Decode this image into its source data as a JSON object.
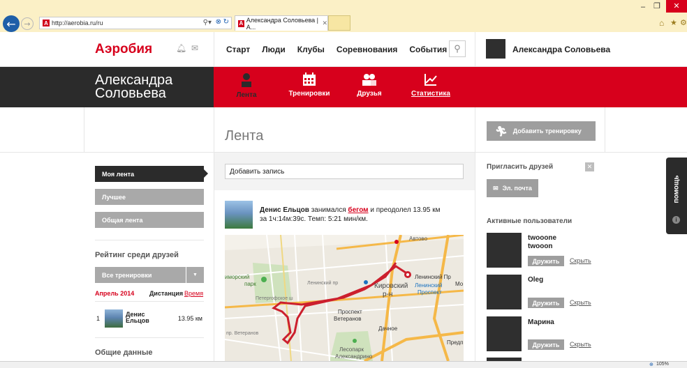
{
  "browser": {
    "url": "http://aerobia.ru/ru",
    "tab_title": "Александра Соловьева | А...",
    "zoom": "105%"
  },
  "site": {
    "logo": "Аэробия",
    "nav": [
      "Старт",
      "Люди",
      "Клубы",
      "Соревнования",
      "События"
    ],
    "user_name": "Александра Соловьева"
  },
  "profile": {
    "name_line1": "Александра",
    "name_line2": "Соловьева",
    "tabs": [
      {
        "label": "Лента",
        "icon": "person-icon",
        "active": true
      },
      {
        "label": "Тренировки",
        "icon": "calendar-icon",
        "active": false
      },
      {
        "label": "Друзья",
        "icon": "friends-icon",
        "active": false
      },
      {
        "label": "Статистика",
        "icon": "chart-icon",
        "active": false
      }
    ]
  },
  "page": {
    "title": "Лента",
    "add_workout": "Добавить тренировку",
    "post_placeholder": "Добавить запись"
  },
  "left_menu": {
    "items": [
      "Моя лента",
      "Лучшее",
      "Общая лента"
    ],
    "rating_title": "Рейтинг среди друзей",
    "rating_select": "Все тренировки",
    "period": "Апрель 2014",
    "col_distance": "Дистанция",
    "col_time": "Время",
    "ranking": [
      {
        "rank": "1",
        "name_line1": "Денис",
        "name_line2": "Ельцов",
        "value": "13.95 км"
      }
    ],
    "general_title": "Общие данные"
  },
  "feed": {
    "author": "Денис Ельцов",
    "text_before": " занимался ",
    "activity": "бегом",
    "text_after": " и преодолел 13.95 км",
    "line2": "за 1ч:14м:39с. Темп: 5:21 мин/км."
  },
  "map": {
    "labels": [
      "Автово",
      "Ленинский Пр",
      "Кировский",
      "р-н",
      "Ленинский",
      "Проспект",
      "Проспект",
      "Ветеранов",
      "Дачное",
      "Лесопарк",
      "Александрино",
      "Предп",
      "иморский",
      "парк",
      "Петергофское ш",
      "пр. Ветеранов",
      "Ленинский пр",
      "Мо"
    ]
  },
  "right": {
    "invite_title": "Пригласить друзей",
    "email_btn": "Эл. почта",
    "active_title": "Активные пользователи",
    "users": [
      {
        "name_line1": "twooone",
        "name_line2": "twooon"
      },
      {
        "name_line1": "Oleg",
        "name_line2": ""
      },
      {
        "name_line1": "Марина",
        "name_line2": ""
      }
    ],
    "befriend": "Дружить",
    "hide": "Скрыть"
  },
  "help_tab": "помощь",
  "colors": {
    "brand_red": "#d7001c",
    "dark": "#2b2b2b",
    "gray_btn": "#a9a9a9"
  }
}
